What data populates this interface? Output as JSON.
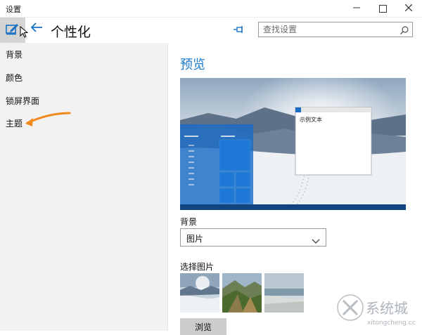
{
  "window": {
    "title": "设置"
  },
  "header": {
    "page_title": "个性化"
  },
  "search": {
    "placeholder": "查找设置"
  },
  "sidebar": {
    "items": [
      {
        "label": "背景"
      },
      {
        "label": "颜色"
      },
      {
        "label": "锁屏界面"
      },
      {
        "label": "主题"
      }
    ]
  },
  "main": {
    "preview_heading": "预览",
    "preview_sample_text": "示例文本",
    "background_label": "背景",
    "background_value": "图片",
    "choose_picture_label": "选择图片",
    "browse_label": "浏览"
  },
  "colors": {
    "accent": "#1979ca",
    "annotation_arrow": "#f08a1c"
  },
  "icons": [
    "edit-icon",
    "back-arrow-icon",
    "pin-icon",
    "search-icon",
    "chevron-down-icon",
    "minimize-icon",
    "maximize-icon",
    "close-icon"
  ],
  "watermark": {
    "brand": "系统城",
    "site": "xitongcheng.cc"
  }
}
